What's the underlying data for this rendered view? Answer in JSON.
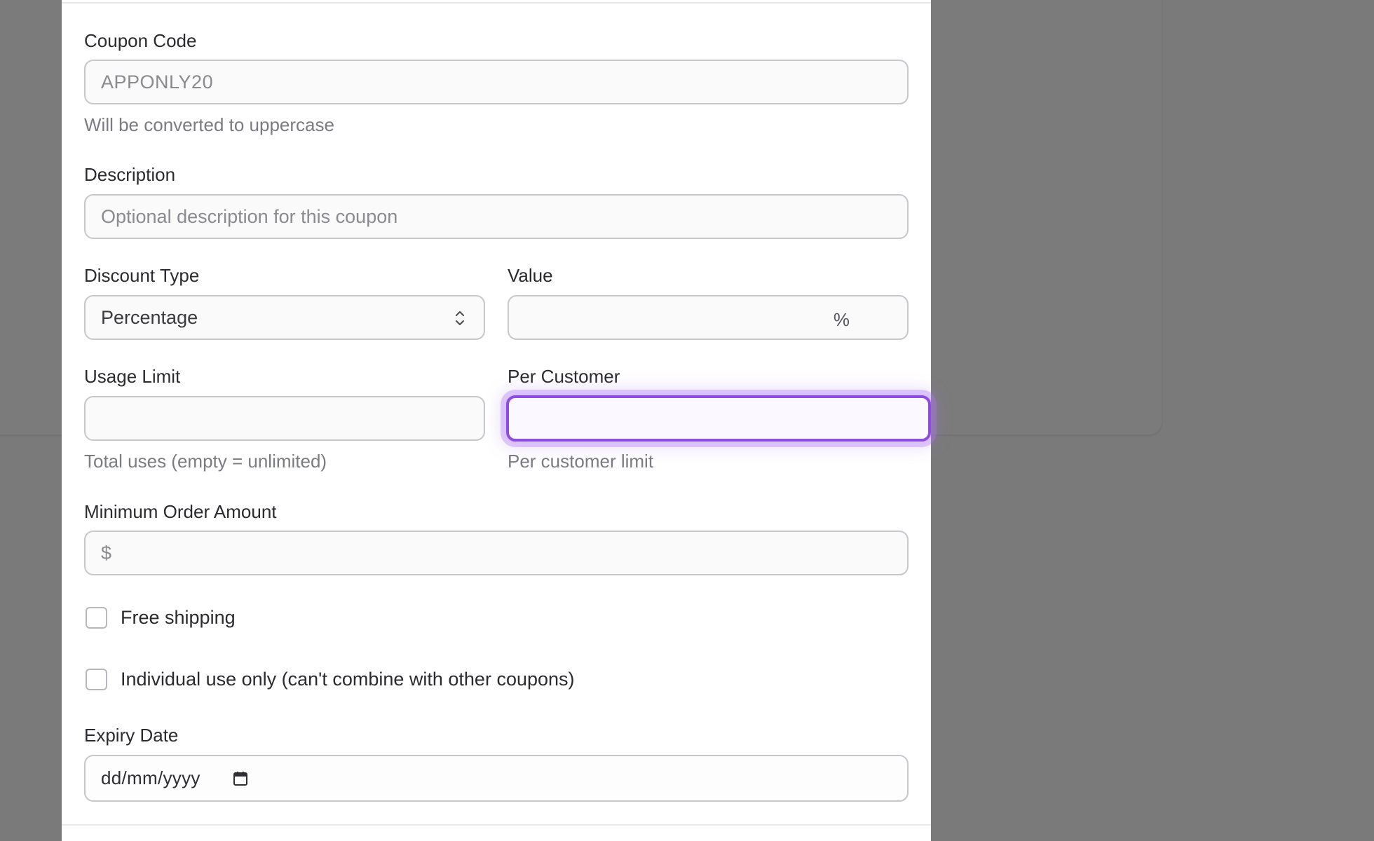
{
  "form": {
    "coupon_code": {
      "label": "Coupon Code",
      "value": "APPONLY20",
      "helper": "Will be converted to uppercase"
    },
    "description": {
      "label": "Description",
      "placeholder": "Optional description for this coupon"
    },
    "discount_type": {
      "label": "Discount Type",
      "selected": "Percentage"
    },
    "value": {
      "label": "Value",
      "suffix": "%"
    },
    "usage_limit": {
      "label": "Usage Limit",
      "helper": "Total uses (empty = unlimited)"
    },
    "per_customer": {
      "label": "Per Customer",
      "helper": "Per customer limit"
    },
    "minimum_order": {
      "label": "Minimum Order Amount",
      "prefix": "$"
    },
    "free_shipping": {
      "label": "Free shipping",
      "checked": false
    },
    "individual_use": {
      "label": "Individual use only (can't combine with other coupons)",
      "checked": false
    },
    "expiry_date": {
      "label": "Expiry Date",
      "placeholder": "dd/mm/yyyy"
    }
  },
  "colors": {
    "focus_ring": "#8f4ce0",
    "overlay": "#7a7a7a"
  },
  "icons": {
    "select": "chevron-up-down-icon",
    "date": "calendar-icon"
  }
}
